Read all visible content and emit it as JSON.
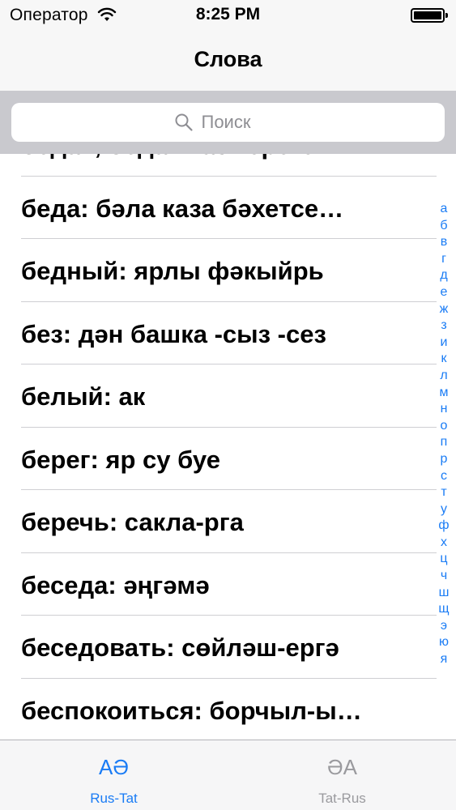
{
  "status_bar": {
    "carrier": "Оператор",
    "time": "8:25 PM"
  },
  "nav": {
    "title": "Слова"
  },
  "search": {
    "placeholder": "Поиск"
  },
  "list": {
    "partial_top": "бедах, бедах каз тереге",
    "items": [
      "беда: бәла  каза  бәхетсе…",
      "бедный: ярлы  фәкыйрь",
      "без: дән башка -сыз -сез",
      "белый: ак",
      "берег: яр су буе",
      "беречь: сакла-рга",
      "беседа: әңгәмә",
      "беседовать: сөйләш-ергә",
      "беспокоиться: борчыл-ы…"
    ]
  },
  "index_letters": [
    "а",
    "б",
    "в",
    "г",
    "д",
    "е",
    "ж",
    "з",
    "и",
    "к",
    "л",
    "м",
    "н",
    "о",
    "п",
    "р",
    "с",
    "т",
    "у",
    "ф",
    "х",
    "ц",
    "ч",
    "ш",
    "щ",
    "э",
    "ю",
    "я"
  ],
  "tabs": [
    {
      "icon_text": "АӘ",
      "label": "Rus-Tat",
      "active": true
    },
    {
      "icon_text": "ӘА",
      "label": "Tat-Rus",
      "active": false
    }
  ],
  "colors": {
    "accent": "#1a7cf5",
    "inactive": "#9a9a9e"
  }
}
